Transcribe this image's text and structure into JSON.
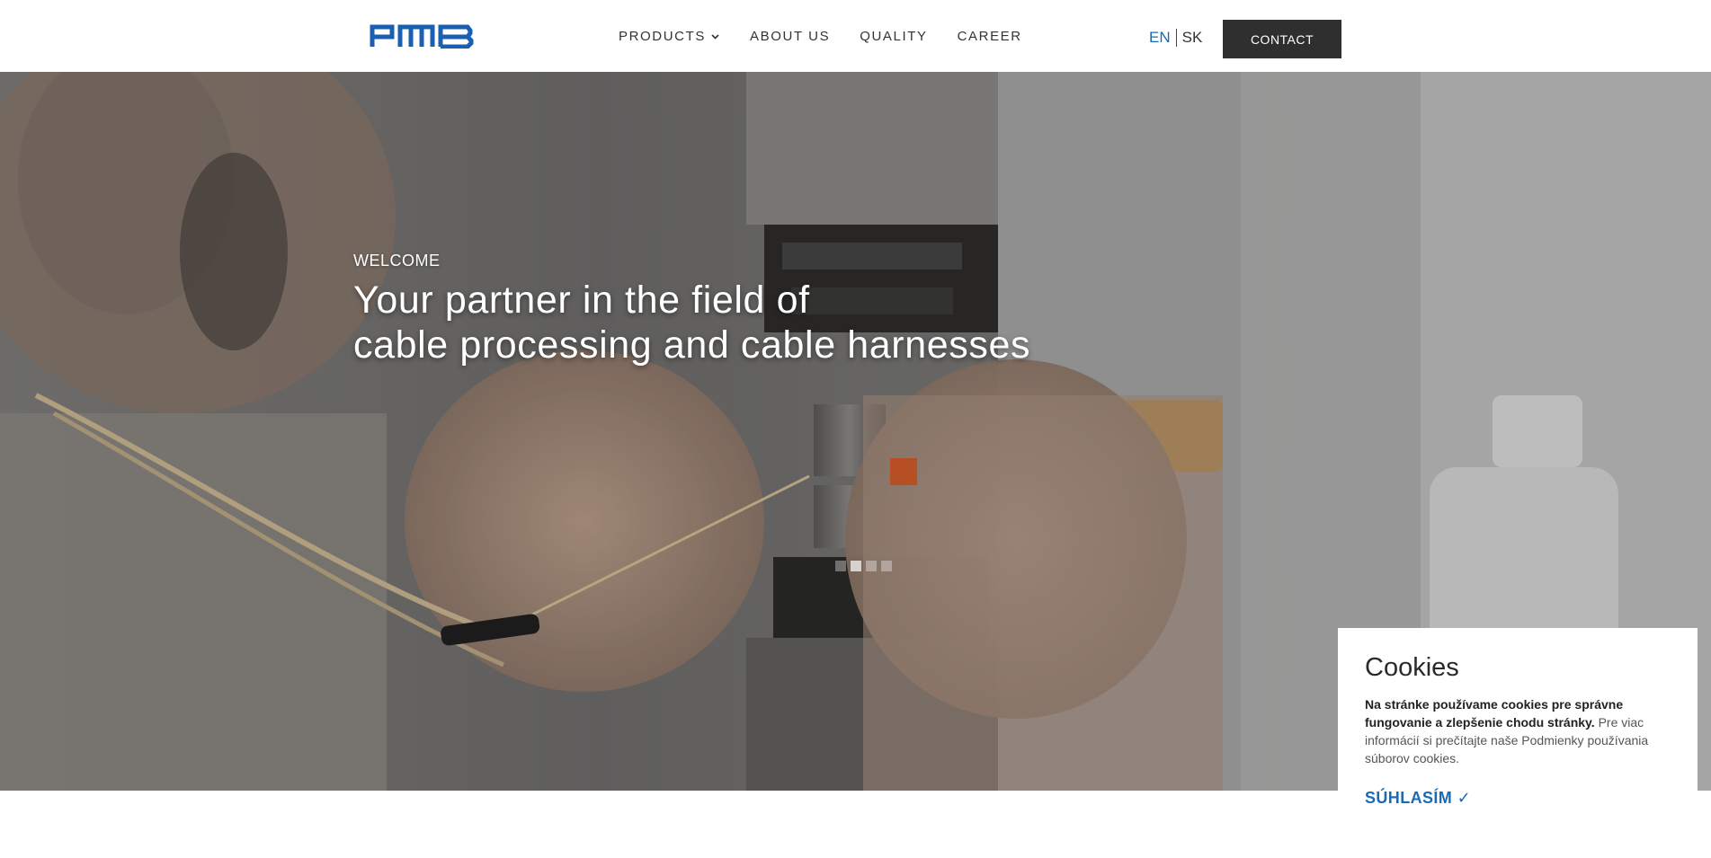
{
  "header": {
    "logo_text": "PMB",
    "nav": [
      {
        "label": "PRODUCTS",
        "has_dropdown": true
      },
      {
        "label": "ABOUT US"
      },
      {
        "label": "QUALITY"
      },
      {
        "label": "CAREER"
      }
    ],
    "languages": {
      "active": "EN",
      "other": "SK"
    },
    "contact_label": "CONTACT"
  },
  "hero": {
    "eyebrow": "WELCOME",
    "headline_line1": "Your partner in the field of",
    "headline_line2": "cable processing and cable harnesses",
    "slides": 4,
    "active_slide": 2
  },
  "cookies": {
    "title": "Cookies",
    "text_bold": "Na stránke používame cookies pre správne fungovanie a zlepšenie chodu stránky.",
    "text_rest": " Pre viac informácií si prečítajte naše Podmienky používania súborov cookies.",
    "accept_label": "SÚHLASÍM ✓"
  },
  "colors": {
    "brand_blue": "#1a6bb5",
    "contact_bg": "#2f2f2f"
  },
  "icons": [
    "chevron-down-icon",
    "checkmark-icon"
  ]
}
